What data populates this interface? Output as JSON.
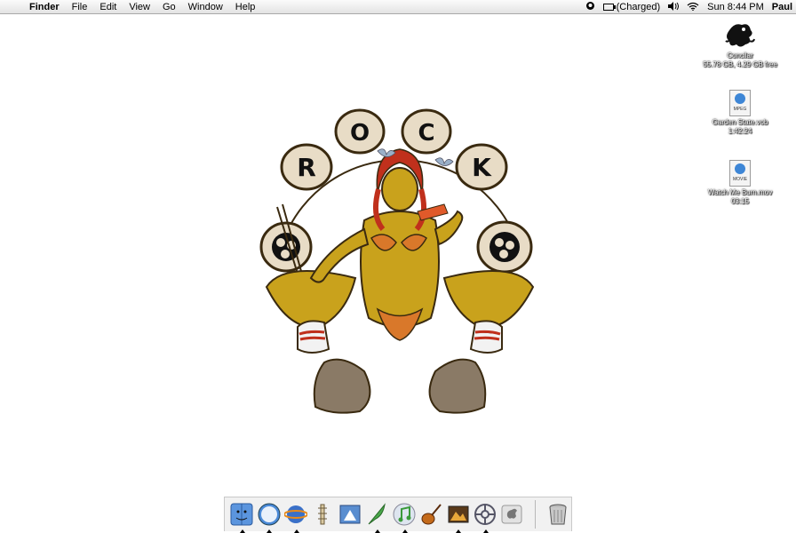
{
  "menubar": {
    "app": "Finder",
    "menus": [
      "File",
      "Edit",
      "View",
      "Go",
      "Window",
      "Help"
    ],
    "battery_status": "(Charged)",
    "clock": "Sun 8:44 PM",
    "user": "Paul"
  },
  "desktop_icons": [
    {
      "name": "Concilar",
      "sub": "55.78 GB, 4.29 GB free",
      "icon": "hard-drive-icon"
    },
    {
      "name": "Garden State.vob",
      "sub": "1:42:24",
      "icon": "mpeg-file-icon",
      "badge": "MPEG"
    },
    {
      "name": "Watch Me Burn.mov",
      "sub": "03:15",
      "icon": "movie-file-icon",
      "badge": "MOVIE"
    }
  ],
  "poster": {
    "letters": [
      "R",
      "O",
      "C",
      "K"
    ],
    "colors": {
      "skin": "#c9a21c",
      "hair": "#c0301c",
      "drum": "#e8dcc6",
      "outline": "#3a2a10"
    }
  },
  "dock": {
    "items": [
      "finder-icon",
      "safari-icon",
      "ichat-icon",
      "preview-icon",
      "mail-icon",
      "quill-icon",
      "itunes-icon",
      "garageband-icon",
      "iphoto-icon",
      "network-icon",
      "apple-icon"
    ],
    "trash": "trash-icon"
  }
}
